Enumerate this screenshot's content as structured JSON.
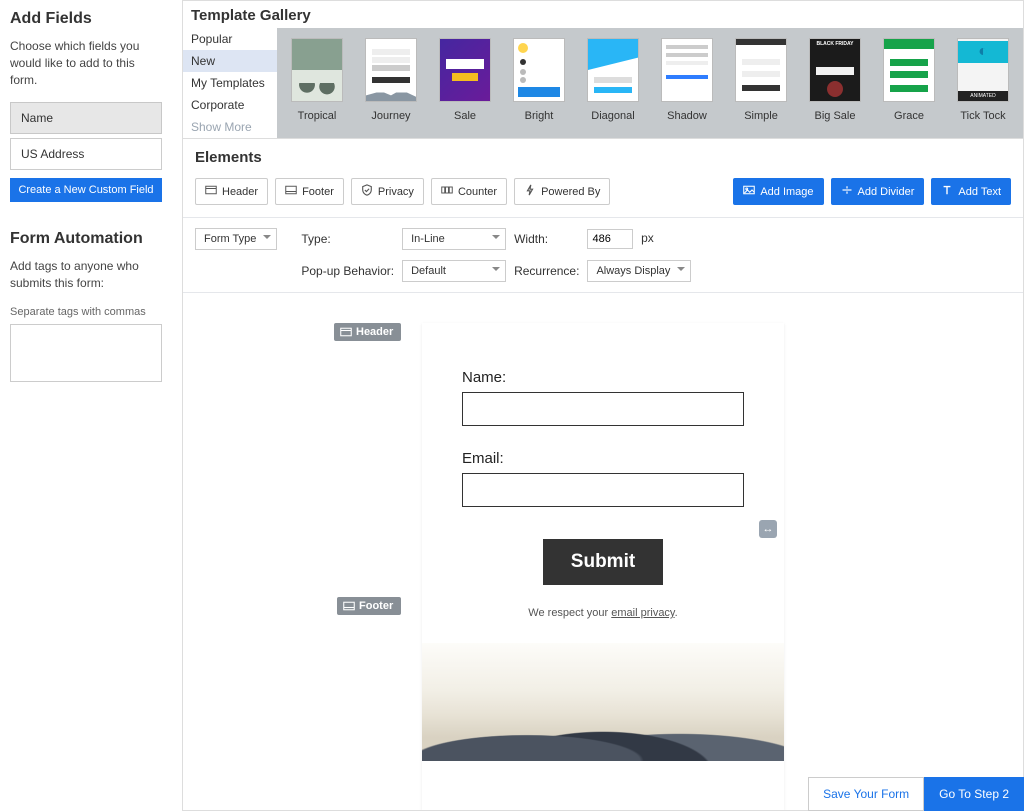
{
  "sidebar": {
    "add_fields_title": "Add Fields",
    "add_fields_desc": "Choose which fields you would like to add to this form.",
    "fields": [
      {
        "label": "Name",
        "selected": true
      },
      {
        "label": "US Address",
        "selected": false
      }
    ],
    "create_custom_btn": "Create a New Custom Field",
    "automation_title": "Form Automation",
    "automation_desc": "Add tags to anyone who submits this form:",
    "tags_help": "Separate tags with commas"
  },
  "gallery": {
    "title": "Template Gallery",
    "nav": [
      "Popular",
      "New",
      "My Templates",
      "Corporate"
    ],
    "nav_active": "New",
    "nav_more": "Show More",
    "templates": [
      {
        "label": "Tropical",
        "klass": "th-tropical"
      },
      {
        "label": "Journey",
        "klass": "th-journey"
      },
      {
        "label": "Sale",
        "klass": "th-sale"
      },
      {
        "label": "Bright",
        "klass": "th-bright"
      },
      {
        "label": "Diagonal",
        "klass": "th-diagonal"
      },
      {
        "label": "Shadow",
        "klass": "th-shadow"
      },
      {
        "label": "Simple",
        "klass": "th-simple"
      },
      {
        "label": "Big Sale",
        "klass": "th-bigsale"
      },
      {
        "label": "Grace",
        "klass": "th-grace"
      },
      {
        "label": "Tick Tock",
        "klass": "th-ticktock"
      }
    ]
  },
  "elements": {
    "title": "Elements",
    "chips": [
      {
        "label": "Header",
        "icon": "header"
      },
      {
        "label": "Footer",
        "icon": "footer"
      },
      {
        "label": "Privacy",
        "icon": "shield"
      },
      {
        "label": "Counter",
        "icon": "counter"
      },
      {
        "label": "Powered By",
        "icon": "bolt"
      }
    ],
    "actions": [
      {
        "label": "Add Image",
        "icon": "image"
      },
      {
        "label": "Add Divider",
        "icon": "divider"
      },
      {
        "label": "Add Text",
        "icon": "text"
      }
    ]
  },
  "config": {
    "form_type_label": "Form Type",
    "type_label": "Type:",
    "type_value": "In-Line",
    "width_label": "Width:",
    "width_value": "486",
    "width_unit": "px",
    "popup_label": "Pop-up Behavior:",
    "popup_value": "Default",
    "recurrence_label": "Recurrence:",
    "recurrence_value": "Always Display"
  },
  "canvas": {
    "header_tag": "Header",
    "footer_tag": "Footer",
    "name_label": "Name:",
    "email_label": "Email:",
    "submit_label": "Submit",
    "privacy_prefix": "We respect your ",
    "privacy_link": "email privacy",
    "privacy_suffix": "."
  },
  "bottom": {
    "save": "Save Your Form",
    "next": "Go To Step 2"
  }
}
